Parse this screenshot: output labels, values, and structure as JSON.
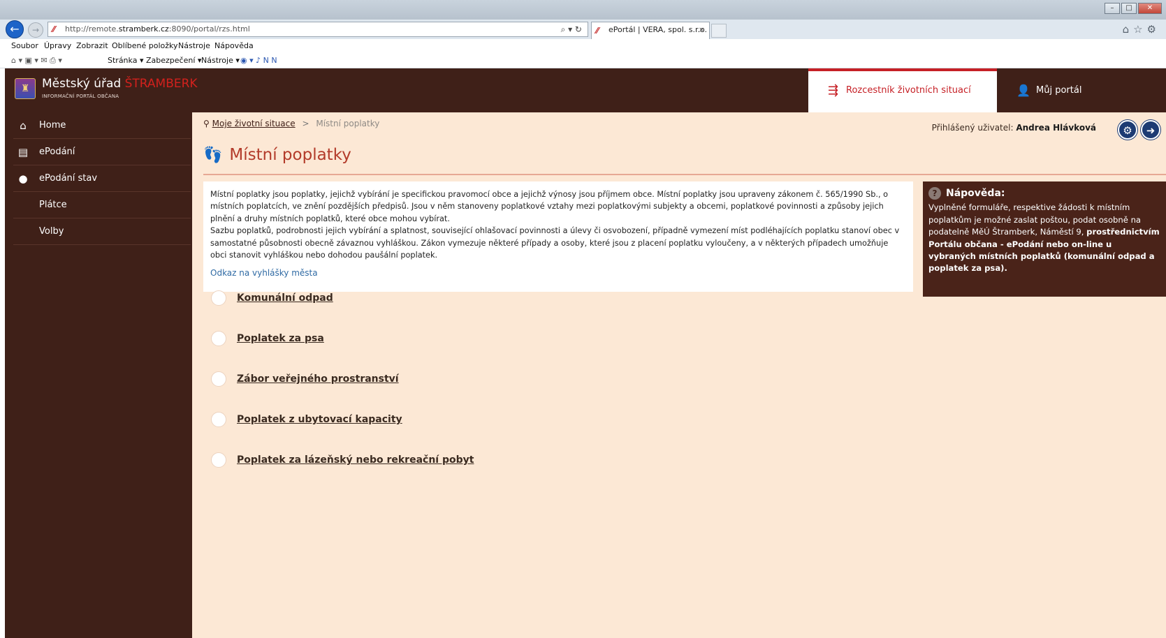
{
  "browser": {
    "url_prefix": "http://remote.",
    "url_host": "stramberk.cz",
    "url_suffix": ":8090/portal/rzs.html",
    "tab_title": "ePortál | VERA, spol. s.r.o.",
    "menu": [
      "Soubor",
      "Úpravy",
      "Zobrazit",
      "Oblíbené položky",
      "Nástroje",
      "Nápověda"
    ],
    "commands": [
      "Stránka ▾",
      "Zabezpečení ▾",
      "Nástroje ▾"
    ]
  },
  "header": {
    "brand_name": "Městský úřad",
    "brand_accent": "ŠTRAMBERK",
    "brand_subtitle": "INFORMAČNÍ PORTÁL OBČANA",
    "nav": {
      "rozcestnik": "Rozcestník životních situací",
      "portal": "Můj portál"
    }
  },
  "sidebar": {
    "items": [
      {
        "label": "Home",
        "icon": "home-icon"
      },
      {
        "label": "ePodání",
        "icon": "document-icon"
      },
      {
        "label": "ePodání stav",
        "icon": "chat-icon"
      },
      {
        "label": "Plátce",
        "icon": ""
      },
      {
        "label": "Volby",
        "icon": ""
      }
    ]
  },
  "breadcrumb": {
    "link": "Moje životní situace",
    "separator": ">",
    "current": "Místní poplatky"
  },
  "user": {
    "label": "Přihlášený uživatel:",
    "name": "Andrea Hlávková"
  },
  "page": {
    "title": "Místní poplatky",
    "intro_p1": "Místní poplatky jsou poplatky, jejichž vybírání je specifickou pravomocí obce a jejichž výnosy jsou příjmem obce. Místní poplatky jsou upraveny zákonem č. 565/1990 Sb., o místních poplatcích, ve znění pozdějších předpisů. Jsou v něm stanoveny poplatkové vztahy mezi poplatkovými subjekty a obcemi, poplatkové povinnosti a způsoby jejich plnění a druhy místních poplatků, které obce mohou vybírat.",
    "intro_p2": "Sazbu poplatků, podrobnosti jejich vybírání a splatnost, související ohlašovací povinnosti a úlevy či osvobození, případně vymezení míst podléhajících poplatku stanoví obec v samostatné působnosti obecně závaznou vyhláškou. Zákon vymezuje některé případy a osoby, které jsou z placení poplatku vyloučeny, a v některých případech umožňuje obci stanovit vyhláškou nebo dohodou paušální poplatek.",
    "odkaz": "Odkaz na vyhlášky města"
  },
  "help": {
    "title": "Nápověda:",
    "text_plain": "Vyplněné formuláře, respektive žádosti k místním poplatkům je možné zaslat poštou, podat osobně na podatelně MěÚ Štramberk, Náměstí 9, ",
    "text_bold": "prostřednictvím Portálu občana - ePodání nebo on-line u vybraných místních poplatků (komunální odpad a poplatek za psa)."
  },
  "fees": [
    "Komunální odpad",
    "Poplatek za psa",
    "Zábor veřejného prostranství",
    "Poplatek z ubytovací kapacity",
    "Poplatek za lázeňský nebo rekreační pobyt"
  ]
}
